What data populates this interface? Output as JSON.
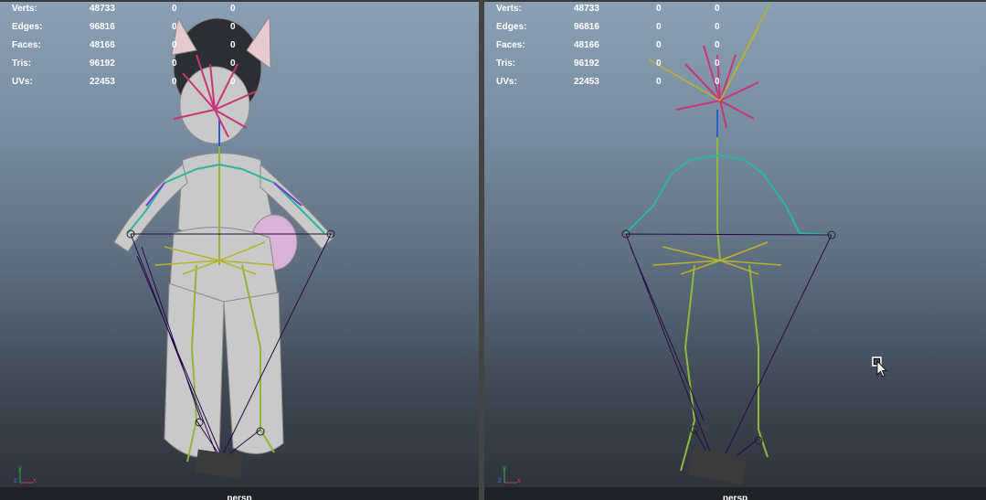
{
  "viewports": [
    {
      "id": "left",
      "camera": "persp",
      "stats": [
        {
          "label": "Verts:",
          "value": "48733",
          "sel": "0",
          "comp": "0"
        },
        {
          "label": "Edges:",
          "value": "96816",
          "sel": "0",
          "comp": "0"
        },
        {
          "label": "Faces:",
          "value": "48166",
          "sel": "0",
          "comp": "0"
        },
        {
          "label": "Tris:",
          "value": "96192",
          "sel": "0",
          "comp": "0"
        },
        {
          "label": "UVs:",
          "value": "22453",
          "sel": "0",
          "comp": "0"
        }
      ],
      "axis": {
        "y": "y",
        "x": "x",
        "z": "z"
      }
    },
    {
      "id": "right",
      "camera": "persp",
      "stats": [
        {
          "label": "Verts:",
          "value": "48733",
          "sel": "0",
          "comp": "0"
        },
        {
          "label": "Edges:",
          "value": "96816",
          "sel": "0",
          "comp": "0"
        },
        {
          "label": "Faces:",
          "value": "48166",
          "sel": "0",
          "comp": "0"
        },
        {
          "label": "Tris:",
          "value": "96192",
          "sel": "0",
          "comp": "0"
        },
        {
          "label": "UVs:",
          "value": "22453",
          "sel": "0",
          "comp": "0"
        }
      ],
      "axis": {
        "y": "y",
        "x": "x",
        "z": "z"
      }
    }
  ],
  "colors": {
    "joint_spine": "#2bb5a0",
    "joint_head": "#c8357a",
    "joint_leg": "#8fb83a",
    "ik_handle": "#2a0a4a"
  }
}
